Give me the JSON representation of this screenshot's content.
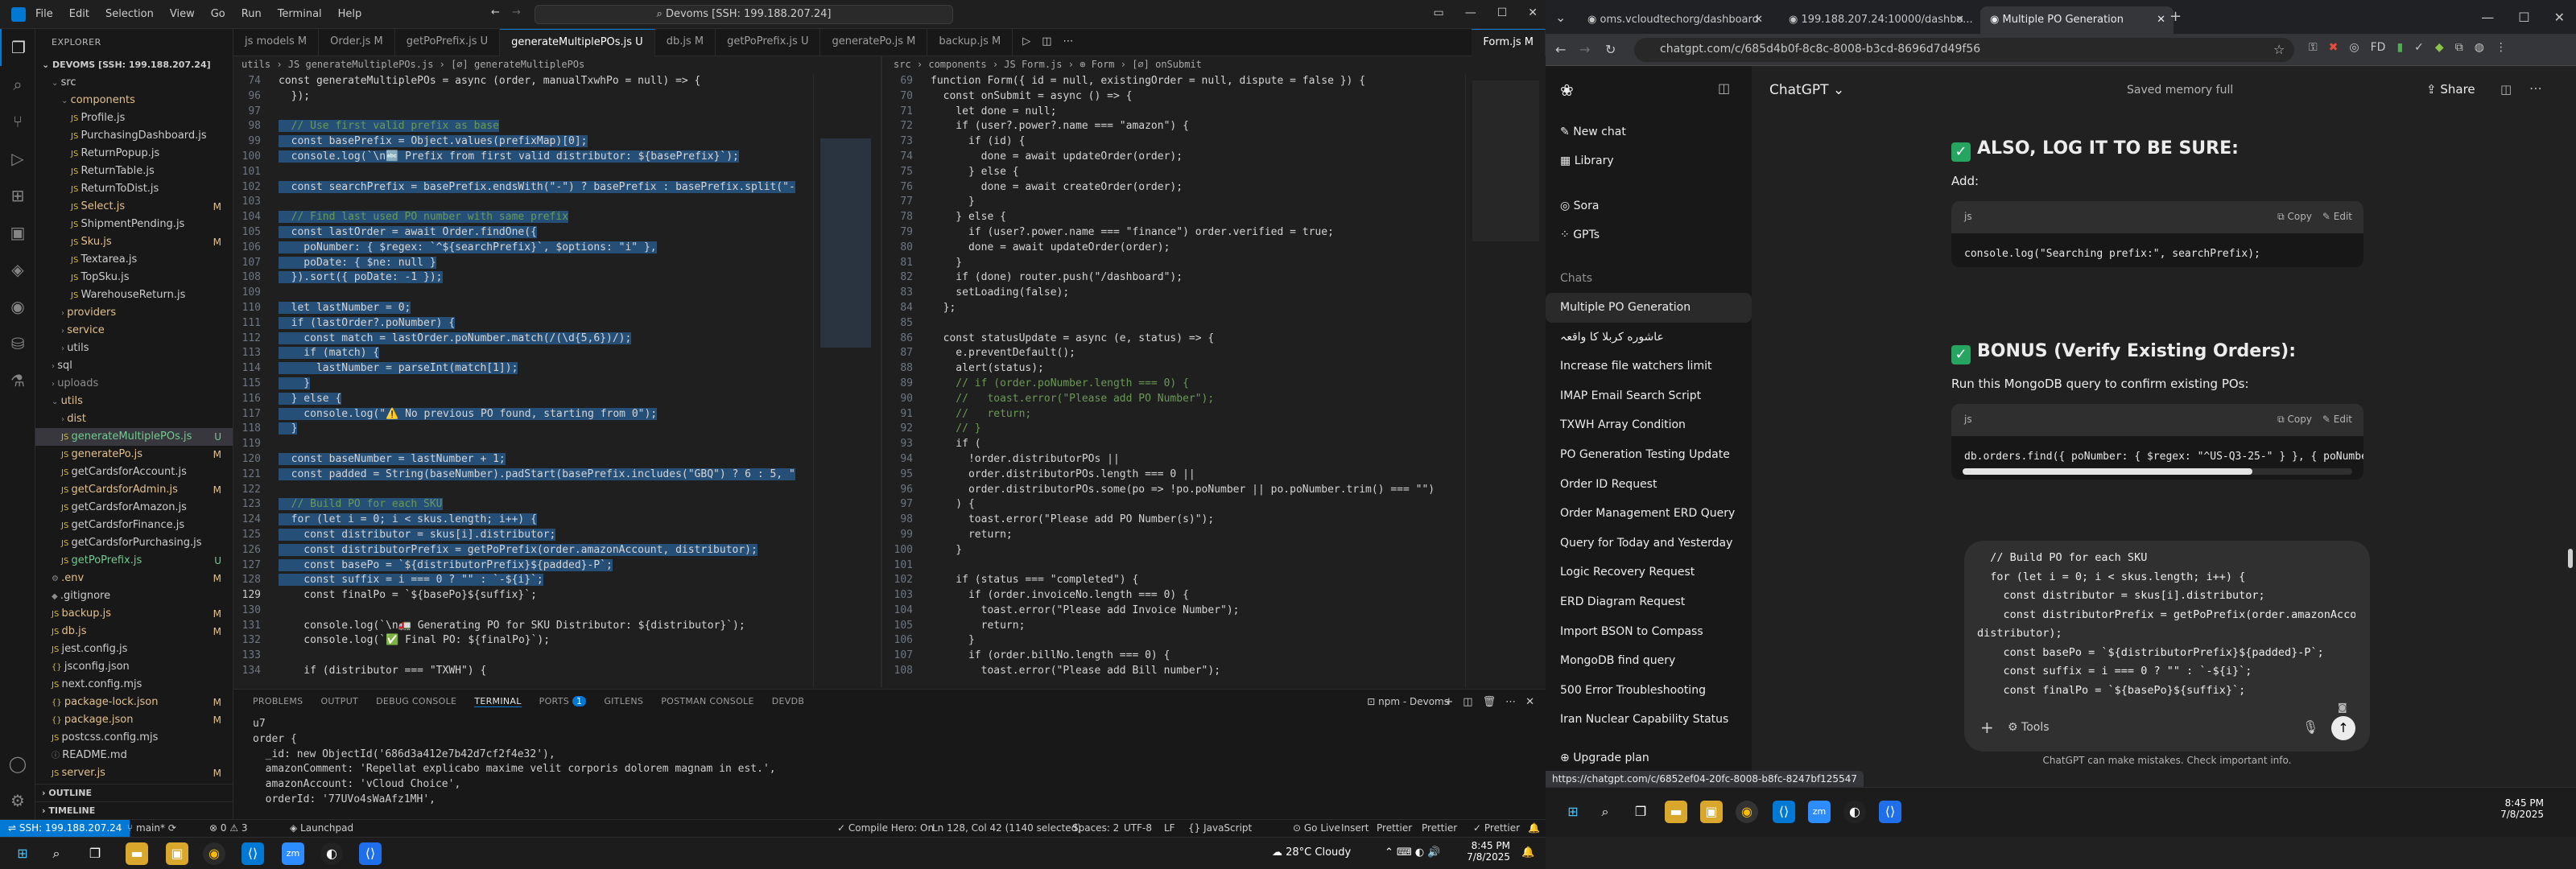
{
  "vscode": {
    "menu": [
      "File",
      "Edit",
      "Selection",
      "View",
      "Go",
      "Run",
      "Terminal",
      "Help"
    ],
    "command_center": "Devoms [SSH: 199.188.207.24]",
    "explorer_header": "EXPLORER",
    "workspace": "DEVOMS [SSH: 199.188.207.24]",
    "tree": [
      {
        "label": "src",
        "indent": 1,
        "badge": "",
        "color": "#cccccc",
        "kind": "folder-open"
      },
      {
        "label": "components",
        "indent": 2,
        "badge": "",
        "color": "#e2c08d",
        "kind": "folder-open"
      },
      {
        "label": "Profile.js",
        "indent": 3,
        "badge": "",
        "color": "#cccccc",
        "kind": "js"
      },
      {
        "label": "PurchasingDashboard.js",
        "indent": 3,
        "badge": "",
        "color": "#cccccc",
        "kind": "js"
      },
      {
        "label": "ReturnPopup.js",
        "indent": 3,
        "badge": "",
        "color": "#cccccc",
        "kind": "js"
      },
      {
        "label": "ReturnTable.js",
        "indent": 3,
        "badge": "",
        "color": "#cccccc",
        "kind": "js"
      },
      {
        "label": "ReturnToDist.js",
        "indent": 3,
        "badge": "",
        "color": "#cccccc",
        "kind": "js"
      },
      {
        "label": "Select.js",
        "indent": 3,
        "badge": "M",
        "color": "#e2c08d",
        "kind": "js"
      },
      {
        "label": "ShipmentPending.js",
        "indent": 3,
        "badge": "",
        "color": "#cccccc",
        "kind": "js"
      },
      {
        "label": "Sku.js",
        "indent": 3,
        "badge": "M",
        "color": "#e2c08d",
        "kind": "js"
      },
      {
        "label": "Textarea.js",
        "indent": 3,
        "badge": "",
        "color": "#cccccc",
        "kind": "js"
      },
      {
        "label": "TopSku.js",
        "indent": 3,
        "badge": "",
        "color": "#cccccc",
        "kind": "js"
      },
      {
        "label": "WarehouseReturn.js",
        "indent": 3,
        "badge": "",
        "color": "#cccccc",
        "kind": "js"
      },
      {
        "label": "providers",
        "indent": 2,
        "badge": "",
        "color": "#e2c08d",
        "kind": "folder"
      },
      {
        "label": "service",
        "indent": 2,
        "badge": "",
        "color": "#e2c08d",
        "kind": "folder"
      },
      {
        "label": "utils",
        "indent": 2,
        "badge": "",
        "color": "#cccccc",
        "kind": "folder"
      },
      {
        "label": "sql",
        "indent": 1,
        "badge": "",
        "color": "#cccccc",
        "kind": "folder"
      },
      {
        "label": "uploads",
        "indent": 1,
        "badge": "",
        "color": "#8c8c8c",
        "kind": "folder"
      },
      {
        "label": "utils",
        "indent": 1,
        "badge": "",
        "color": "#e2c08d",
        "kind": "folder-open"
      },
      {
        "label": "dist",
        "indent": 2,
        "badge": "",
        "color": "#e2c08d",
        "kind": "folder"
      },
      {
        "label": "generateMultiplePOs.js",
        "indent": 2,
        "badge": "U",
        "color": "#73c991",
        "kind": "js",
        "active": true
      },
      {
        "label": "generatePo.js",
        "indent": 2,
        "badge": "M",
        "color": "#e2c08d",
        "kind": "js"
      },
      {
        "label": "getCardsforAccount.js",
        "indent": 2,
        "badge": "",
        "color": "#cccccc",
        "kind": "js"
      },
      {
        "label": "getCardsforAdmin.js",
        "indent": 2,
        "badge": "M",
        "color": "#e2c08d",
        "kind": "js"
      },
      {
        "label": "getCardsforAmazon.js",
        "indent": 2,
        "badge": "",
        "color": "#cccccc",
        "kind": "js"
      },
      {
        "label": "getCardsforFinance.js",
        "indent": 2,
        "badge": "",
        "color": "#cccccc",
        "kind": "js"
      },
      {
        "label": "getCardsforPurchasing.js",
        "indent": 2,
        "badge": "",
        "color": "#cccccc",
        "kind": "js"
      },
      {
        "label": "getPoPrefix.js",
        "indent": 2,
        "badge": "U",
        "color": "#73c991",
        "kind": "js"
      },
      {
        "label": ".env",
        "indent": 1,
        "badge": "M",
        "color": "#e2c08d",
        "kind": "env"
      },
      {
        "label": ".gitignore",
        "indent": 1,
        "badge": "",
        "color": "#cccccc",
        "kind": "git"
      },
      {
        "label": "backup.js",
        "indent": 1,
        "badge": "M",
        "color": "#e2c08d",
        "kind": "js"
      },
      {
        "label": "db.js",
        "indent": 1,
        "badge": "M",
        "color": "#e2c08d",
        "kind": "js"
      },
      {
        "label": "jest.config.js",
        "indent": 1,
        "badge": "",
        "color": "#cccccc",
        "kind": "js"
      },
      {
        "label": "jsconfig.json",
        "indent": 1,
        "badge": "",
        "color": "#cccccc",
        "kind": "json"
      },
      {
        "label": "next.config.mjs",
        "indent": 1,
        "badge": "",
        "color": "#cccccc",
        "kind": "js"
      },
      {
        "label": "package-lock.json",
        "indent": 1,
        "badge": "M",
        "color": "#e2c08d",
        "kind": "json"
      },
      {
        "label": "package.json",
        "indent": 1,
        "badge": "M",
        "color": "#e2c08d",
        "kind": "json"
      },
      {
        "label": "postcss.config.mjs",
        "indent": 1,
        "badge": "",
        "color": "#cccccc",
        "kind": "js"
      },
      {
        "label": "README.md",
        "indent": 1,
        "badge": "",
        "color": "#cccccc",
        "kind": "md"
      },
      {
        "label": "server.js",
        "indent": 1,
        "badge": "M",
        "color": "#e2c08d",
        "kind": "js"
      }
    ],
    "outline": "OUTLINE",
    "timeline": "TIMELINE",
    "tabs": [
      {
        "label": "js models M",
        "active": false
      },
      {
        "label": "Order.js M",
        "active": false
      },
      {
        "label": "getPoPrefix.js U",
        "active": false
      },
      {
        "label": "generateMultiplePOs.js U",
        "active": true
      },
      {
        "label": "db.js M",
        "active": false
      },
      {
        "label": "getPoPrefix.js U",
        "active": false
      },
      {
        "label": "generatePo.js M",
        "active": false
      },
      {
        "label": "backup.js M",
        "active": false
      },
      {
        "label": "Form.js M",
        "active": true
      }
    ],
    "breadcrumb_left": "utils › JS generateMultiplePOs.js › [∅] generateMultiplePOs",
    "breadcrumb_right": "src › components › JS Form.js › ⊕ Form › [∅] onSubmit",
    "left_editor": [
      {
        "n": "74",
        "t": "const generateMultiplePOs = async (order, manualTxwhPo = null) => {",
        "s": false
      },
      {
        "n": "96",
        "t": "  });",
        "s": false
      },
      {
        "n": "97",
        "t": "",
        "s": false
      },
      {
        "n": "98",
        "t": "  // Use first valid prefix as base",
        "s": true
      },
      {
        "n": "99",
        "t": "  const basePrefix = Object.values(prefixMap)[0];",
        "s": true
      },
      {
        "n": "100",
        "t": "  console.log(`\\n🔤 Prefix from first valid distributor: ${basePrefix}`);",
        "s": true
      },
      {
        "n": "101",
        "t": "",
        "s": true
      },
      {
        "n": "102",
        "t": "  const searchPrefix = basePrefix.endsWith(\"-\") ? basePrefix : basePrefix.split(\"-",
        "s": true
      },
      {
        "n": "103",
        "t": "",
        "s": true
      },
      {
        "n": "104",
        "t": "  // Find last used PO number with same prefix",
        "s": true
      },
      {
        "n": "105",
        "t": "  const lastOrder = await Order.findOne({",
        "s": true
      },
      {
        "n": "106",
        "t": "    poNumber: { $regex: `^${searchPrefix}`, $options: \"i\" },",
        "s": true
      },
      {
        "n": "107",
        "t": "    poDate: { $ne: null }",
        "s": true
      },
      {
        "n": "108",
        "t": "  }).sort({ poDate: -1 });",
        "s": true
      },
      {
        "n": "109",
        "t": "",
        "s": true
      },
      {
        "n": "110",
        "t": "  let lastNumber = 0;",
        "s": true
      },
      {
        "n": "111",
        "t": "  if (lastOrder?.poNumber) {",
        "s": true
      },
      {
        "n": "112",
        "t": "    const match = lastOrder.poNumber.match(/(\\d{5,6})/);",
        "s": true
      },
      {
        "n": "113",
        "t": "    if (match) {",
        "s": true
      },
      {
        "n": "114",
        "t": "      lastNumber = parseInt(match[1]);",
        "s": true
      },
      {
        "n": "115",
        "t": "    }",
        "s": true
      },
      {
        "n": "116",
        "t": "  } else {",
        "s": true
      },
      {
        "n": "117",
        "t": "    console.log(\"⚠️ No previous PO found, starting from 0\");",
        "s": true
      },
      {
        "n": "118",
        "t": "  }",
        "s": true
      },
      {
        "n": "119",
        "t": "",
        "s": true
      },
      {
        "n": "120",
        "t": "  const baseNumber = lastNumber + 1;",
        "s": true
      },
      {
        "n": "121",
        "t": "  const padded = String(baseNumber).padStart(basePrefix.includes(\"GBQ\") ? 6 : 5, \"",
        "s": true
      },
      {
        "n": "122",
        "t": "",
        "s": true
      },
      {
        "n": "123",
        "t": "  // Build PO for each SKU",
        "s": true
      },
      {
        "n": "124",
        "t": "  for (let i = 0; i < skus.length; i++) {",
        "s": true
      },
      {
        "n": "125",
        "t": "    const distributor = skus[i].distributor;",
        "s": true
      },
      {
        "n": "126",
        "t": "    const distributorPrefix = getPoPrefix(order.amazonAccount, distributor);",
        "s": true
      },
      {
        "n": "127",
        "t": "    const basePo = `${distributorPrefix}${padded}-P`;",
        "s": true
      },
      {
        "n": "128",
        "t": "    const suffix = i === 0 ? \"\" : `-${i}`;",
        "s": true
      },
      {
        "n": "129",
        "t": "    const finalPo = `${basePo}${suffix}`;",
        "s": false,
        "cur": true
      },
      {
        "n": "130",
        "t": "",
        "s": false
      },
      {
        "n": "131",
        "t": "    console.log(`\\n🚛 Generating PO for SKU Distributor: ${distributor}`);",
        "s": false
      },
      {
        "n": "132",
        "t": "    console.log(`✅ Final PO: ${finalPo}`);",
        "s": false
      },
      {
        "n": "133",
        "t": "",
        "s": false
      },
      {
        "n": "134",
        "t": "    if (distributor === \"TXWH\") {",
        "s": false
      }
    ],
    "right_editor": [
      {
        "n": "69",
        "t": "function Form({ id = null, existingOrder = null, dispute = false }) {"
      },
      {
        "n": "70",
        "t": "  const onSubmit = async () => {"
      },
      {
        "n": "71",
        "t": "    let done = null;"
      },
      {
        "n": "72",
        "t": "    if (user?.power?.name === \"amazon\") {"
      },
      {
        "n": "73",
        "t": "      if (id) {"
      },
      {
        "n": "74",
        "t": "        done = await updateOrder(order);"
      },
      {
        "n": "75",
        "t": "      } else {"
      },
      {
        "n": "76",
        "t": "        done = await createOrder(order);"
      },
      {
        "n": "77",
        "t": "      }"
      },
      {
        "n": "78",
        "t": "    } else {"
      },
      {
        "n": "79",
        "t": "      if (user?.power.name === \"finance\") order.verified = true;"
      },
      {
        "n": "80",
        "t": "      done = await updateOrder(order);"
      },
      {
        "n": "81",
        "t": "    }"
      },
      {
        "n": "82",
        "t": "    if (done) router.push(\"/dashboard\");"
      },
      {
        "n": "83",
        "t": "    setLoading(false);"
      },
      {
        "n": "84",
        "t": "  };"
      },
      {
        "n": "85",
        "t": ""
      },
      {
        "n": "86",
        "t": "  const statusUpdate = async (e, status) => {"
      },
      {
        "n": "87",
        "t": "    e.preventDefault();"
      },
      {
        "n": "88",
        "t": "    alert(status);"
      },
      {
        "n": "89",
        "t": "    // if (order.poNumber.length === 0) {"
      },
      {
        "n": "90",
        "t": "    //   toast.error(\"Please add PO Number\");"
      },
      {
        "n": "91",
        "t": "    //   return;"
      },
      {
        "n": "92",
        "t": "    // }"
      },
      {
        "n": "93",
        "t": "    if ("
      },
      {
        "n": "94",
        "t": "      !order.distributorPOs ||"
      },
      {
        "n": "95",
        "t": "      order.distributorPOs.length === 0 ||"
      },
      {
        "n": "96",
        "t": "      order.distributorPOs.some(po => !po.poNumber || po.poNumber.trim() === \"\")"
      },
      {
        "n": "97",
        "t": "    ) {"
      },
      {
        "n": "98",
        "t": "      toast.error(\"Please add PO Number(s)\");"
      },
      {
        "n": "99",
        "t": "      return;"
      },
      {
        "n": "100",
        "t": "    }"
      },
      {
        "n": "101",
        "t": ""
      },
      {
        "n": "102",
        "t": "    if (status === \"completed\") {"
      },
      {
        "n": "103",
        "t": "      if (order.invoiceNo.length === 0) {"
      },
      {
        "n": "104",
        "t": "        toast.error(\"Please add Invoice Number\");"
      },
      {
        "n": "105",
        "t": "        return;"
      },
      {
        "n": "106",
        "t": "      }"
      },
      {
        "n": "107",
        "t": "      if (order.billNo.length === 0) {"
      },
      {
        "n": "108",
        "t": "        toast.error(\"Please add Bill number\");"
      }
    ],
    "panel_tabs": [
      "PROBLEMS",
      "OUTPUT",
      "DEBUG CONSOLE",
      "TERMINAL",
      "PORTS",
      "GITLENS",
      "POSTMAN CONSOLE",
      "DEVDB"
    ],
    "ports_count": "1",
    "terminal_task": "npm - Devoms",
    "terminal_lines": [
      "u7",
      "order {",
      "  _id: new ObjectId('686d3a412e7b42d7cf2f4e32'),",
      "  amazonComment: 'Repellat explicabo maxime velit corporis dolorem magnam in est.',",
      "  amazonAccount: 'vCloud Choice',",
      "  orderId: '77UVo4sWaAfz1MH',"
    ],
    "status": {
      "remote": "SSH: 199.188.207.24",
      "branch": "main*",
      "sync": "⟳",
      "errors": "⊗ 0 ⚠ 3",
      "launchpad": "Launchpad",
      "compile": "Compile Hero: On",
      "position": "Ln 128, Col 42 (1140 selected)",
      "spaces": "Spaces: 2",
      "encoding": "UTF-8",
      "eol": "LF",
      "language": "{} JavaScript",
      "golive": "Go Live",
      "insert": "Insert",
      "prettier": "Prettier"
    }
  },
  "chrome": {
    "tabs": [
      {
        "label": "oms.vcloudtechorg/dashboard",
        "active": false
      },
      {
        "label": "199.188.207.24:10000/dashbo...",
        "active": false
      },
      {
        "label": "Multiple PO Generation",
        "active": true
      }
    ],
    "url": "chatgpt.com/c/685d4b0f-8c8c-8008-b3cd-8696d7d49f56",
    "status_url": "https://chatgpt.com/c/6852ef04-20fc-8008-b8fc-8247bf125547"
  },
  "chatgpt": {
    "new_chat": "New chat",
    "library": "Library",
    "sora": "Sora",
    "gpts": "GPTs",
    "chats_header": "Chats",
    "chats": [
      "Multiple PO Generation",
      "عاشوره کربلا کا واقعہ",
      "Increase file watchers limit",
      "IMAP Email Search Script",
      "TXWH Array Condition",
      "PO Generation Testing Update",
      "Order ID Request",
      "Order Management ERD Query",
      "Query for Today and Yesterday",
      "Logic Recovery Request",
      "ERD Diagram Request",
      "Import BSON to Compass",
      "MongoDB find query",
      "500 Error Troubleshooting",
      "Iran Nuclear Capability Status"
    ],
    "upgrade": "Upgrade plan",
    "model": "ChatGPT",
    "memory": "Saved memory full",
    "share": "Share",
    "heading1": "ALSO, LOG IT TO BE SURE:",
    "add_label": "Add:",
    "code1_lang": "js",
    "copy": "Copy",
    "edit": "Edit",
    "code1": "console.log(\"Searching prefix:\", searchPrefix);",
    "heading2": "BONUS (Verify Existing Orders):",
    "bonus_text": "Run this MongoDB query to confirm existing POs:",
    "code2_lang": "js",
    "code2": "db.orders.find({ poNumber: { $regex: \"^US-Q3-25-\" } }, { poNumbe",
    "composer_lines": [
      "  // Build PO for each SKU",
      "  for (let i = 0; i < skus.length; i++) {",
      "    const distributor = skus[i].distributor;",
      "    const distributorPrefix = getPoPrefix(order.amazonAccount,",
      "distributor);",
      "    const basePo = `${distributorPrefix}${padded}-P`;",
      "    const suffix = i === 0 ? \"\" : `-${i}`;",
      "    const finalPo = `${basePo}${suffix}`;"
    ],
    "tools": "Tools",
    "disclaimer": "ChatGPT can make mistakes. Check important info."
  },
  "taskbar": {
    "left_time": "8:45 PM",
    "left_date": "7/8/2025",
    "weather": "28°C  Cloudy",
    "right_time": "8:45 PM",
    "right_date": "7/8/2025"
  }
}
